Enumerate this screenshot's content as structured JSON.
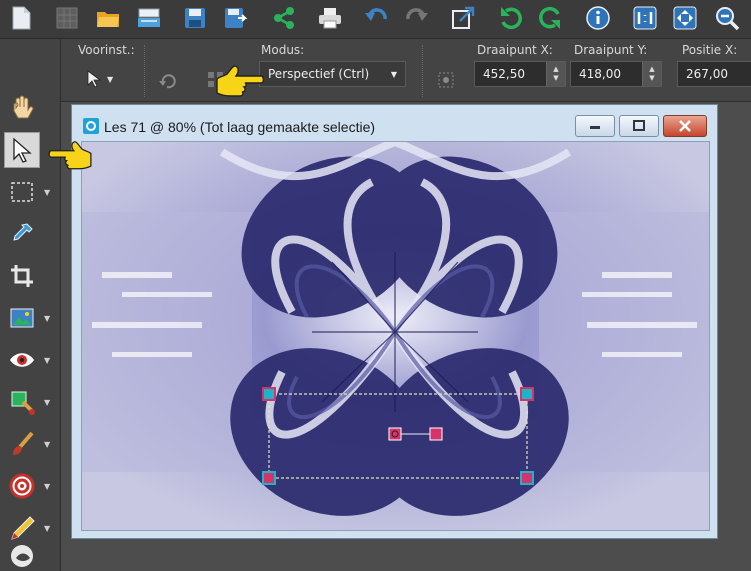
{
  "toolbar": {
    "buttons": [
      {
        "name": "new-file-icon",
        "color": "#e8eef4"
      },
      {
        "name": "grid-icon",
        "color": "#6a6a6a"
      },
      {
        "name": "open-folder-icon",
        "color": "#f2b43c"
      },
      {
        "name": "scan-icon",
        "color": "#4aa3df"
      },
      {
        "name": "save-icon",
        "color": "#3d82c4"
      },
      {
        "name": "save-as-icon",
        "color": "#3d82c4"
      },
      {
        "name": "share-icon",
        "color": "#29b35b"
      },
      {
        "name": "print-icon",
        "color": "#dddddd"
      },
      {
        "name": "undo-icon",
        "color": "#3d82c4"
      },
      {
        "name": "redo-icon",
        "color": "#7a7a7a"
      },
      {
        "name": "resize-icon",
        "color": "#3d82c4"
      },
      {
        "name": "rotate-left-icon",
        "color": "#29b35b"
      },
      {
        "name": "rotate-right-icon",
        "color": "#29b35b"
      },
      {
        "name": "info-icon",
        "color": "#3d82c4"
      },
      {
        "name": "actual-size-icon",
        "color": "#3d82c4"
      },
      {
        "name": "fit-window-icon",
        "color": "#3d82c4"
      },
      {
        "name": "zoom-icon",
        "color": "#3d82c4"
      }
    ]
  },
  "options": {
    "presets_label": "Voorinst.:",
    "mode_label": "Modus:",
    "mode_value": "Perspectief (Ctrl)",
    "pivot_x_label": "Draaipunt X:",
    "pivot_x_value": "452,50",
    "pivot_y_label": "Draaipunt Y:",
    "pivot_y_value": "418,00",
    "position_x_label": "Positie X:",
    "position_x_value": "267,00"
  },
  "document": {
    "title": "Les 71 @  80% (Tot laag gemaakte selectie)"
  },
  "colors": {
    "accent_yellow": "#f7d417",
    "canvas_dark": "#2a2a6e",
    "canvas_light": "#e8e8f4",
    "handle_pink": "#d6336c",
    "handle_cyan": "#1fb3c7"
  }
}
